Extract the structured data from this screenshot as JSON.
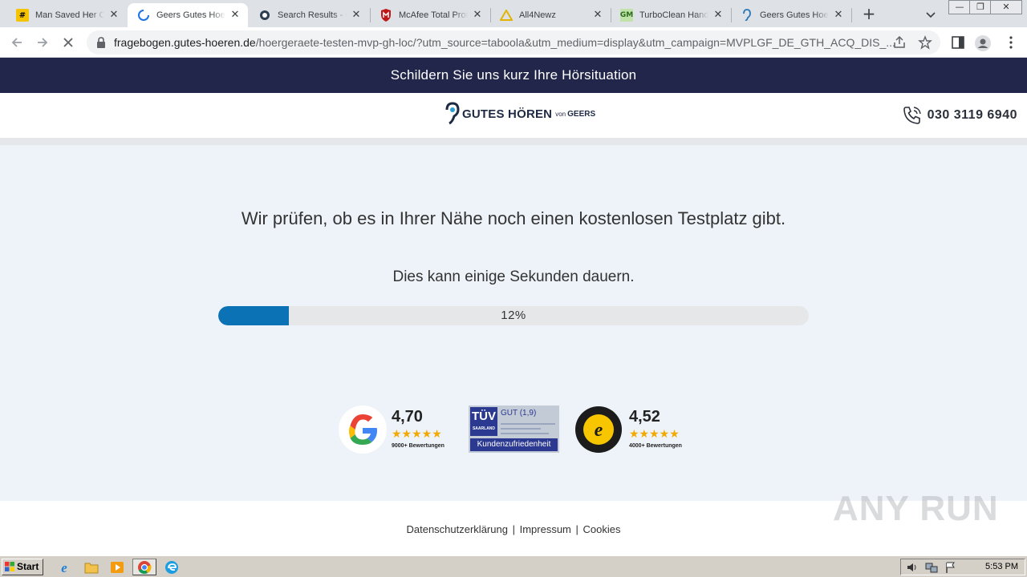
{
  "browser": {
    "tabs": [
      {
        "title": "Man Saved Her Cu",
        "favicon": "hash-icon",
        "active": false
      },
      {
        "title": "Geers Gutes Hoer",
        "favicon": "loading-spinner-icon",
        "active": true
      },
      {
        "title": "Search Results - C",
        "favicon": "search-globe-icon",
        "active": false
      },
      {
        "title": "McAfee Total Prote",
        "favicon": "mcafee-shield-icon",
        "active": false
      },
      {
        "title": "All4Newz",
        "favicon": "all4newz-icon",
        "active": false
      },
      {
        "title": "TurboClean Hands",
        "favicon": "gm-icon",
        "active": false
      },
      {
        "title": "Geers Gutes Hoer",
        "favicon": "ear-icon",
        "active": false
      }
    ],
    "url_host": "fragebogen.gutes-hoeren.de",
    "url_path": "/hoergeraete-testen-mvp-gh-loc/?utm_source=taboola&utm_medium=display&utm_campaign=MVPLGF_DE_GTH_ACQ_DIS_..."
  },
  "page": {
    "banner_text": "Schildern Sie uns kurz Ihre Hörsituation",
    "logo": {
      "main": "GUTES HÖREN",
      "von": "von",
      "brand": "GEERS"
    },
    "phone_number": "030 3119 6940",
    "headline": "Wir prüfen, ob es in Ihrer Nähe noch einen kostenlosen Testplatz gibt.",
    "subline": "Dies kann einige Sekunden dauern.",
    "progress": {
      "percent": 12,
      "label": "12%"
    },
    "ratings": {
      "google": {
        "score": "4,70",
        "stars": "★★★★★",
        "count": "9000+ Bewertungen"
      },
      "tuev": {
        "brand": "TÜV",
        "region": "SAARLAND",
        "grade": "GUT (1,9)",
        "footer": "Kundenzufriedenheit"
      },
      "trusted_shops": {
        "score": "4,52",
        "stars": "★★★★★",
        "count": "4000+ Bewertungen"
      }
    },
    "footer_links": [
      "Datenschutzerklärung",
      "Impressum",
      "Cookies"
    ],
    "watermark": "ANY RUN"
  },
  "taskbar": {
    "start_label": "Start",
    "clock": "5:53 PM"
  },
  "colors": {
    "banner_bg": "#22264a",
    "progress_fill": "#0b72b5",
    "main_bg": "#eef3f9",
    "star": "#f2a900"
  }
}
